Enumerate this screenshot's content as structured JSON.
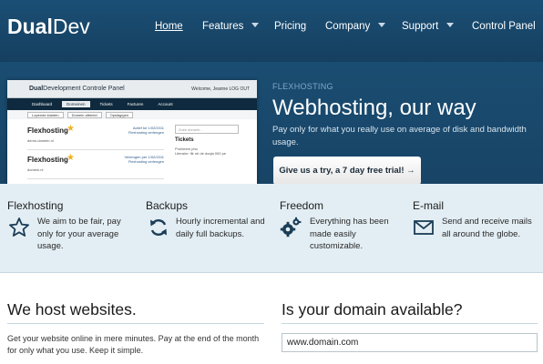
{
  "header": {
    "logo_bold": "Dual",
    "logo_light": "Dev",
    "nav": [
      {
        "label": "Home"
      },
      {
        "label": "Features"
      },
      {
        "label": "Pricing"
      },
      {
        "label": "Company"
      },
      {
        "label": "Support"
      },
      {
        "label": "Control Panel"
      }
    ]
  },
  "hero": {
    "kicker": "FLEXHOSTING",
    "title": "Webhosting, our way",
    "description": "Pay only for what you really use on average of disk and bandwidth usage.",
    "cta_label": "Give us a try, a 7 day free trial! →",
    "screenshot": {
      "title_bold": "Dual",
      "title_rest": "Development Controle Panel",
      "user": "Welcome, Jeanne   LOG OUT",
      "nav": [
        "Dashboard",
        "Domeinen",
        "Tickets",
        "Facturen",
        "Account"
      ],
      "subnav": [
        "Lopende klanten",
        "Domein afbeeld",
        "Opslag/gen"
      ],
      "cards": [
        {
          "name": "Flexhosting",
          "meta": "Actief tot 1/02/2011\nFlexhosting verlengen",
          "domain": "demo-domein.nl"
        },
        {
          "name": "Flexhosting",
          "meta": "Verlengen per 1/02/2011\nFlexhosting verlengen",
          "domain": "domein.nl"
        }
      ],
      "domain_placeholder": "Zoek domein...",
      "tickets_label": "Tickets",
      "ticket_line": "Probleem pho\nLiteraire: fik nh de doqla 000 pe"
    }
  },
  "features": [
    {
      "title": "Flexhosting",
      "text": "We aim to be fair, pay only for your average usage.",
      "icon": "star-icon"
    },
    {
      "title": "Backups",
      "text": "Hourly incremental and daily full backups.",
      "icon": "refresh-icon"
    },
    {
      "title": "Freedom",
      "text": "Everything has been made easily customizable.",
      "icon": "gears-icon"
    },
    {
      "title": "E-mail",
      "text": "Send and receive mails all around the globe.",
      "icon": "envelope-icon"
    }
  ],
  "host": {
    "title": "We host websites.",
    "text": "Get your website online in mere minutes. Pay at the end of the month for only what you use. Keep it simple."
  },
  "domain": {
    "title": "Is your domain available?",
    "value": "www.domain.com"
  },
  "colors": {
    "header": "#1b4f75",
    "features_bg": "#e3eef4",
    "accent": "#7fa8c8"
  }
}
